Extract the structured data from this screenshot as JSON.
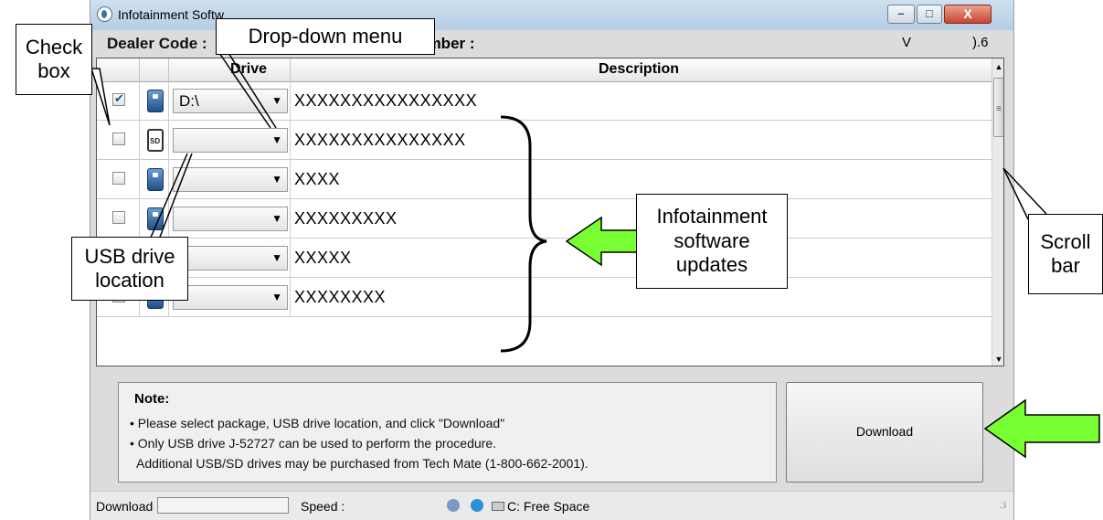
{
  "window": {
    "title": "Infotainment Softw",
    "dealer_code_label": "Dealer Code :",
    "key_number_label": "Key Number :",
    "version_a": "V",
    "version_b": ").6",
    "controls": {
      "minimize": "–",
      "maximize": "□",
      "close": "X"
    }
  },
  "table": {
    "columns": {
      "drive": "Drive",
      "description": "Description"
    },
    "rows": [
      {
        "checked": true,
        "device": "usb",
        "drive": "D:\\",
        "description": "XXXXXXXXXXXXXXXX"
      },
      {
        "checked": false,
        "device": "sd",
        "drive": "",
        "description": "XXXXXXXXXXXXXXX"
      },
      {
        "checked": false,
        "device": "usb",
        "drive": "",
        "description": "XXXX"
      },
      {
        "checked": false,
        "device": "usb",
        "drive": "",
        "description": "XXXXXXXXX"
      },
      {
        "checked": false,
        "device": "usb",
        "drive": "",
        "description": "XXXXX"
      },
      {
        "checked": false,
        "device": "usb",
        "drive": "",
        "description": "XXXXXXXX"
      }
    ],
    "scroll_up": "▲",
    "scroll_down": "▼",
    "scroll_grip": "≡"
  },
  "note": {
    "title": "Note:",
    "lines": [
      "• Please select package, USB drive location, and click \"Download\"",
      "• Only USB drive J-52727 can be used to perform the procedure.",
      "  Additional USB/SD drives may be purchased from Tech Mate (1-800-662-2001)."
    ]
  },
  "download_button": "Download",
  "status_bar": {
    "download_label": "Download :",
    "speed_label": "Speed :",
    "free_space": "C: Free Space",
    "grip": ".:i"
  },
  "callouts": {
    "check_box": "Check box",
    "drop_down_menu": "Drop-down menu",
    "usb_drive_location": "USB drive location",
    "infotainment_updates": "Infotainment software updates",
    "scroll_bar": "Scroll bar"
  },
  "colors": {
    "arrow_fill": "#77ff33",
    "titlebar": "#c4d6ea",
    "close_button": "#c9452f"
  }
}
